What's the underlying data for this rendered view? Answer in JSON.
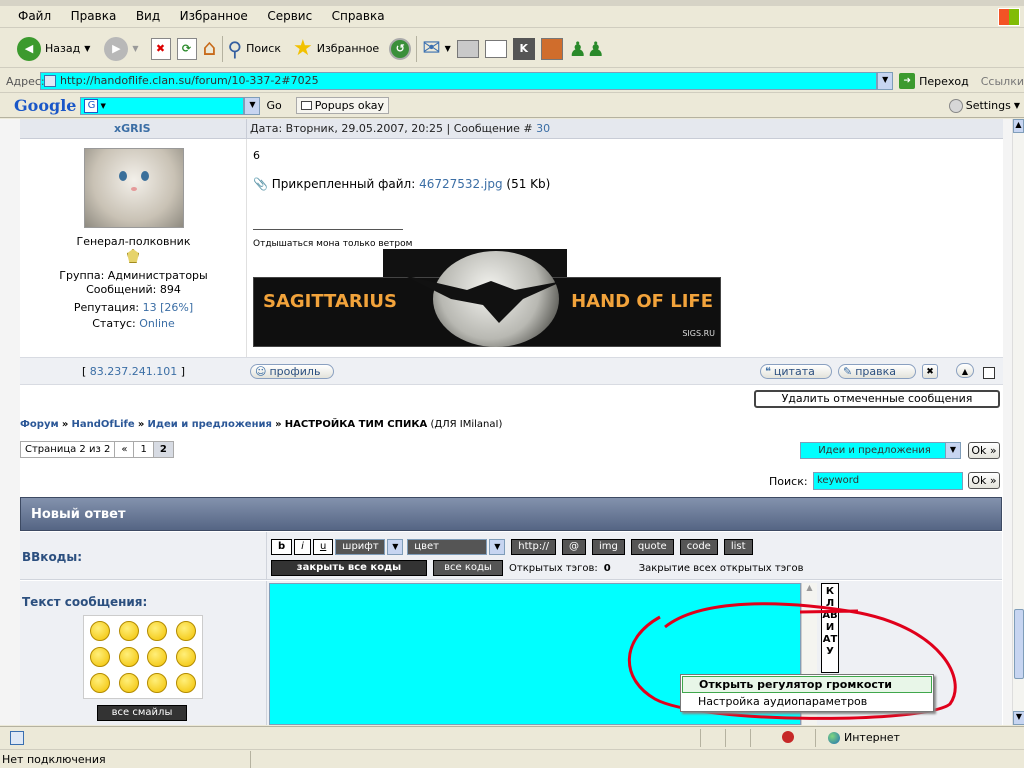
{
  "menu": [
    "Файл",
    "Правка",
    "Вид",
    "Избранное",
    "Сервис",
    "Справка"
  ],
  "toolbar": {
    "back": "Назад",
    "search": "Поиск",
    "favorites": "Избранное"
  },
  "address": {
    "label": "Адрес:",
    "url": "http://handoflife.clan.su/forum/10-337-2#7025",
    "go": "Переход",
    "links": "Ссылки"
  },
  "google": {
    "logo": "Google",
    "go": "Go",
    "popups": "Popups okay",
    "settings": "Settings"
  },
  "post": {
    "author": "xGRIS",
    "header_date": "Дата: Вторник, 29.05.2007, 20:25 | Сообщение #",
    "header_num": "30",
    "rank": "Генерал-полковник",
    "group": "Группа: Администраторы",
    "posts": "Сообщений: 894",
    "rep_label": "Репутация:",
    "rep_value": "13 [26%]",
    "status_label": "Статус:",
    "status_value": "Online",
    "body_text": "6",
    "attach_label": "Прикрепленный файл:",
    "attach_file": "46727532.jpg",
    "attach_size": "(51 Kb)",
    "signature": "Отдышаться мона только ветром",
    "banner_left": "SAGITTARIUS",
    "banner_right": "HAND OF LIFE",
    "banner_site": "SIGS.RU",
    "ip_open": "[",
    "ip": "83.237.241.101",
    "ip_close": "]",
    "btn_profile": "профиль",
    "btn_quote": "цитата",
    "btn_edit": "правка"
  },
  "delete_selected": "Удалить отмеченные сообщения",
  "breadcrumb": {
    "forum": "Форум",
    "sep": "»",
    "section": "HandOfLife",
    "sub": "Идеи и предложения",
    "topic": "НАСТРОЙКА ТИМ СПИКА",
    "topic_suffix": "(ДЛЯ IMilanaI)"
  },
  "pager": {
    "label": "Страница 2 из 2",
    "prev": "«",
    "p1": "1",
    "p2": "2"
  },
  "jump": {
    "value": "Идеи и предложения",
    "ok": "Ok »"
  },
  "search": {
    "label": "Поиск:",
    "value": "keyword",
    "ok": "Ok »"
  },
  "reply": {
    "title": "Новый ответ",
    "bbcodes_label": "BBкоды:",
    "font": "шрифт",
    "color": "цвет",
    "btns": [
      "http://",
      "@",
      "img",
      "quote",
      "code",
      "list"
    ],
    "close_all": "закрыть все коды",
    "all_codes": "все коды",
    "open_tags_label": "Открытых тэгов:",
    "open_tags": "0",
    "close_all_label": "Закрытие всех открытых тэгов",
    "msg_label": "Текст сообщения:",
    "all_smiles": "все смайлы",
    "keyboard": "КЛАВИАТУ"
  },
  "context_menu": {
    "item1": "Открыть регулятор громкости",
    "item2": "Настройка аудиопараметров"
  },
  "status": {
    "zone": "Интернет",
    "connection": "Нет подключения"
  },
  "colors": {
    "accent_cyan": "#00ffff",
    "link": "#3b6ea5",
    "header_bar": "#5a6c8c",
    "annotation": "#e0001b"
  }
}
